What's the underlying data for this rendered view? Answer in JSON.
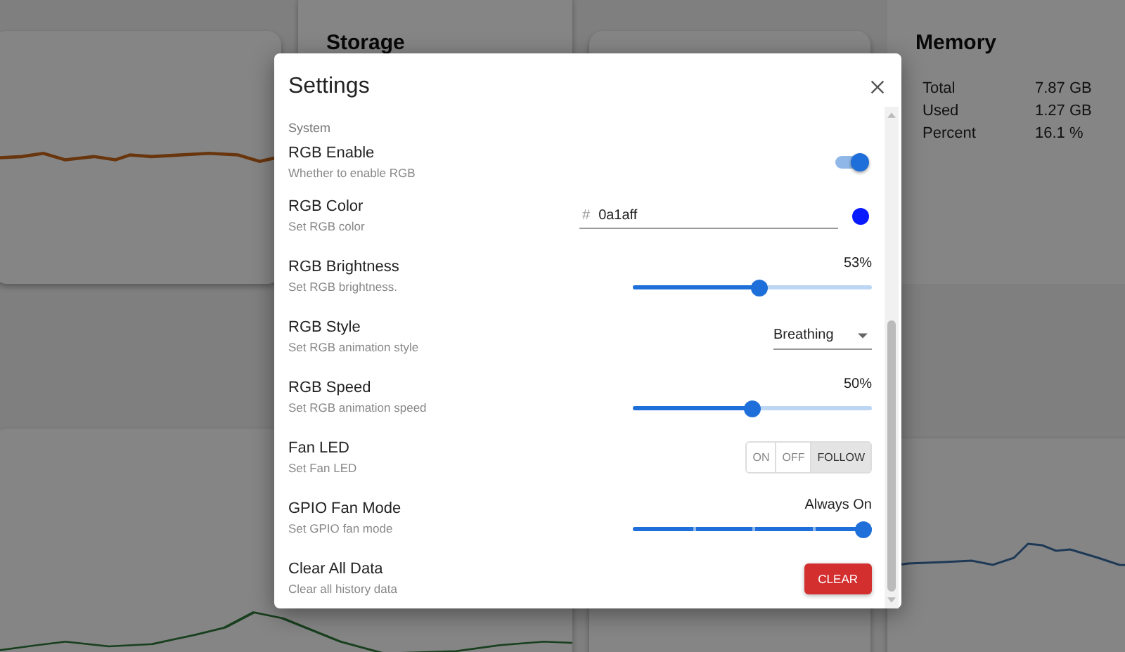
{
  "dashboard": {
    "storage_title": "Storage",
    "memory": {
      "title": "Memory",
      "rows": [
        {
          "label": "Total",
          "value": "7.87 GB"
        },
        {
          "label": "Used",
          "value": "1.27 GB"
        },
        {
          "label": "Percent",
          "value": "16.1 %"
        }
      ]
    }
  },
  "settings": {
    "title": "Settings",
    "section": "System",
    "items": [
      {
        "kind": "toggle",
        "label": "RGB Enable",
        "description": "Whether to enable RGB",
        "on": true
      },
      {
        "kind": "color",
        "label": "RGB Color",
        "description": "Set RGB color",
        "prefix": "#",
        "value": "0a1aff",
        "color": "#0a1aff"
      },
      {
        "kind": "slider",
        "label": "RGB Brightness",
        "description": "Set RGB brightness.",
        "reading": "53%",
        "level": 0.53
      },
      {
        "kind": "select",
        "label": "RGB Style",
        "description": "Set RGB animation style",
        "value": "Breathing"
      },
      {
        "kind": "slider",
        "label": "RGB Speed",
        "description": "Set RGB animation speed",
        "reading": "50%",
        "level": 0.5
      },
      {
        "kind": "segmented",
        "label": "Fan LED",
        "description": "Set Fan LED",
        "options": [
          {
            "label": "ON",
            "selected": false
          },
          {
            "label": "OFF",
            "selected": false
          },
          {
            "label": "FOLLOW",
            "selected": true
          }
        ]
      },
      {
        "kind": "stepslider",
        "label": "GPIO Fan Mode",
        "description": "Set GPIO fan mode",
        "reading": "Always On",
        "level": 1
      },
      {
        "kind": "action",
        "label": "Clear All Data",
        "description": "Clear all history data",
        "button": "CLEAR"
      }
    ]
  }
}
